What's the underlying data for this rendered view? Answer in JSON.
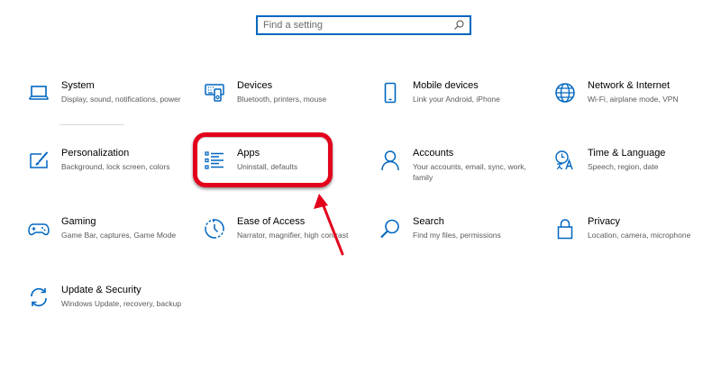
{
  "search": {
    "placeholder": "Find a setting",
    "icon": "search-icon"
  },
  "accent_color": "#0067c0",
  "annotation_color": "#e3001b",
  "tiles": [
    {
      "id": "system",
      "title": "System",
      "desc": "Display, sound, notifications, power",
      "icon": "laptop-icon"
    },
    {
      "id": "devices",
      "title": "Devices",
      "desc": "Bluetooth, printers, mouse",
      "icon": "devices-icon"
    },
    {
      "id": "mobile",
      "title": "Mobile devices",
      "desc": "Link your Android, iPhone",
      "icon": "phone-icon"
    },
    {
      "id": "network",
      "title": "Network & Internet",
      "desc": "Wi-Fi, airplane mode, VPN",
      "icon": "globe-icon"
    },
    {
      "id": "personalization",
      "title": "Personalization",
      "desc": "Background, lock screen, colors",
      "icon": "paint-icon"
    },
    {
      "id": "apps",
      "title": "Apps",
      "desc": "Uninstall, defaults",
      "icon": "apps-list-icon"
    },
    {
      "id": "accounts",
      "title": "Accounts",
      "desc": "Your accounts, email, sync, work, family",
      "icon": "person-icon"
    },
    {
      "id": "time",
      "title": "Time & Language",
      "desc": "Speech, region, date",
      "icon": "time-language-icon"
    },
    {
      "id": "gaming",
      "title": "Gaming",
      "desc": "Game Bar, captures, Game Mode",
      "icon": "gamepad-icon"
    },
    {
      "id": "ease",
      "title": "Ease of Access",
      "desc": "Narrator, magnifier, high contrast",
      "icon": "ease-of-access-icon"
    },
    {
      "id": "search",
      "title": "Search",
      "desc": "Find my files, permissions",
      "icon": "magnifier-icon"
    },
    {
      "id": "privacy",
      "title": "Privacy",
      "desc": "Location, camera, microphone",
      "icon": "lock-icon"
    },
    {
      "id": "update",
      "title": "Update & Security",
      "desc": "Windows Update, recovery, backup",
      "icon": "sync-icon"
    }
  ]
}
